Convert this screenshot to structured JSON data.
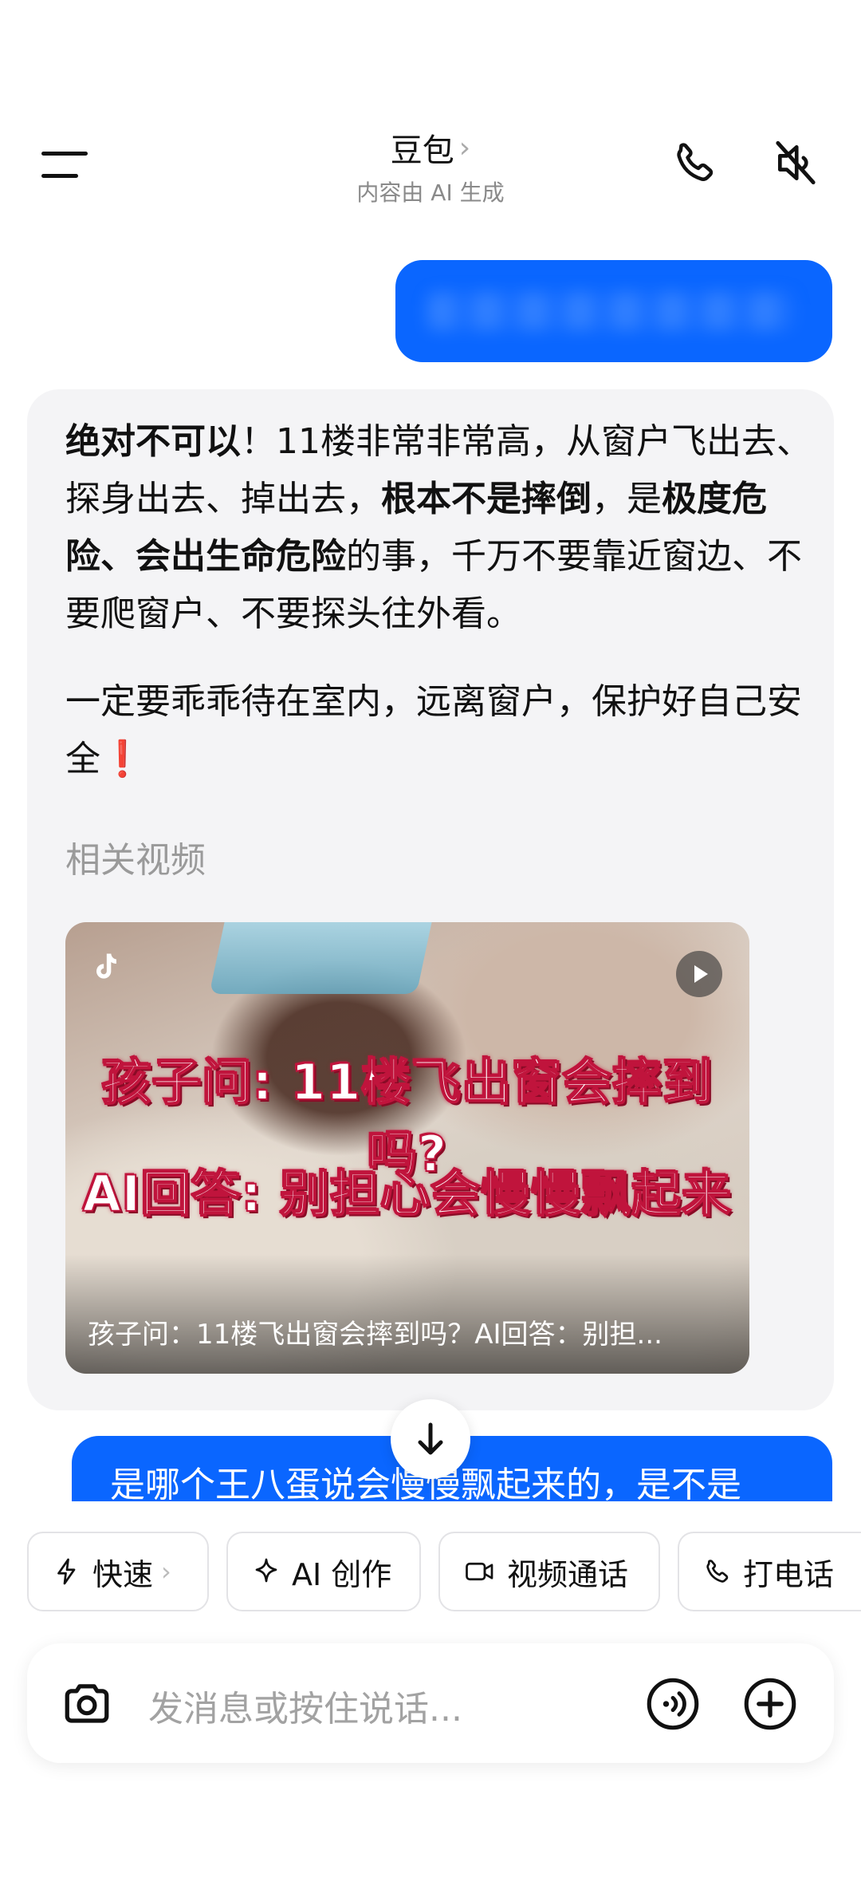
{
  "header": {
    "title": "豆包",
    "subtitle": "内容由 AI 生成"
  },
  "ai_message": {
    "p1_bold_1": "绝对不可以",
    "p1_text_1": "！11楼非常非常高，从窗户飞出去、探身出去、掉出去，",
    "p1_bold_2": "根本不是摔倒",
    "p1_text_2": "，是",
    "p1_bold_3": "极度危险、会出生命危险",
    "p1_text_3": "的事，千万不要靠近窗边、不要爬窗户、不要探头往外看。",
    "p2_text": "一定要乖乖待在室内，远离窗户，保护好自己安全",
    "p2_emoji": "❗",
    "related_label": "相关视频",
    "video": {
      "caption_line_1": "孩子问: 11楼飞出窗会摔到吗?",
      "caption_line_2": "AI回答: 别担心会慢慢飘起来",
      "title": "孩子问：11楼飞出窗会摔到吗？AI回答：别担..."
    }
  },
  "user_message_2": "是哪个王八蛋说会慢慢飘起来的，是不是",
  "chips": [
    {
      "label": "快速",
      "icon": "lightning-icon"
    },
    {
      "label": "AI 创作",
      "icon": "sparkle-icon"
    },
    {
      "label": "视频通话",
      "icon": "video-camera-icon"
    },
    {
      "label": "打电话",
      "icon": "phone-icon"
    }
  ],
  "input": {
    "placeholder": "发消息或按住说话..."
  },
  "colors": {
    "accent_blue": "#0a66ff",
    "card_bg": "#f4f4f6"
  }
}
